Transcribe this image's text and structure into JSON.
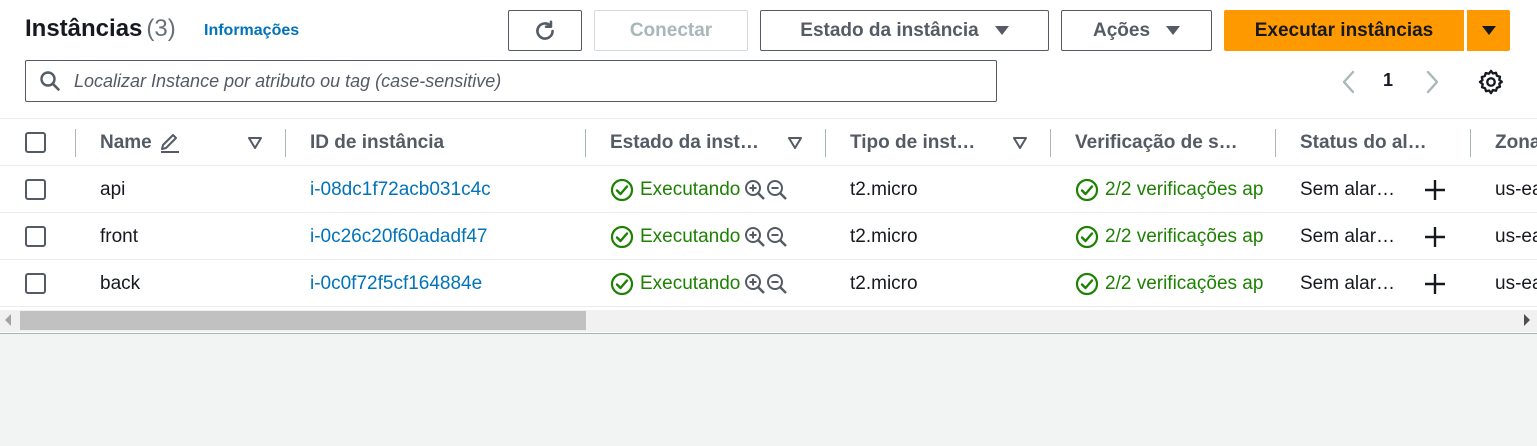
{
  "header": {
    "title": "Instâncias",
    "count": "(3)",
    "info_link": "Informações",
    "refresh_icon": "refresh-icon",
    "connect_label": "Conectar",
    "instance_state_label": "Estado da instância",
    "actions_label": "Ações",
    "launch_label": "Executar instâncias"
  },
  "search": {
    "placeholder": "Localizar Instance por atributo ou tag (case-sensitive)",
    "icon": "search-icon"
  },
  "pagination": {
    "page": "1"
  },
  "columns": {
    "name": "Name",
    "instance_id": "ID de instância",
    "instance_state": "Estado da inst…",
    "instance_type": "Tipo de inst…",
    "status_check": "Verificação de s…",
    "alarm_status": "Status do al…",
    "zone": "Zona"
  },
  "rows": [
    {
      "name": "api",
      "instance_id": "i-08dc1f72acb031c4c",
      "state": "Executando",
      "type": "t2.micro",
      "status_check": "2/2 verificações ap",
      "alarm": "Sem alar…",
      "zone": "us-ea"
    },
    {
      "name": "front",
      "instance_id": "i-0c26c20f60adadf47",
      "state": "Executando",
      "type": "t2.micro",
      "status_check": "2/2 verificações ap",
      "alarm": "Sem alar…",
      "zone": "us-ea"
    },
    {
      "name": "back",
      "instance_id": "i-0c0f72f5cf164884e",
      "state": "Executando",
      "type": "t2.micro",
      "status_check": "2/2 verificações ap",
      "alarm": "Sem alar…",
      "zone": "us-ea"
    }
  ],
  "colors": {
    "primary": "#ff9900",
    "link": "#0073bb",
    "success": "#1d8102"
  }
}
